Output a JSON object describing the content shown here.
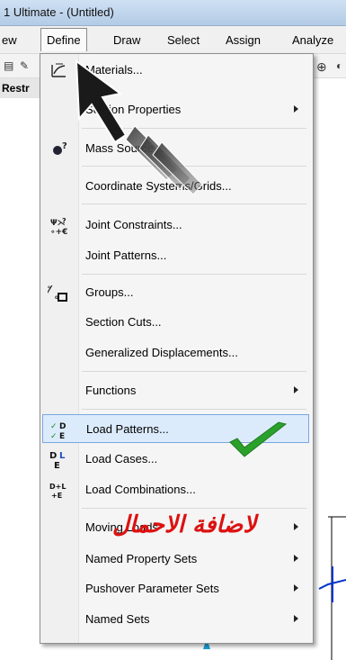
{
  "window": {
    "title": "1 Ultimate  - (Untitled)"
  },
  "menubar": {
    "items": [
      {
        "label": "ew"
      },
      {
        "label": "Define"
      },
      {
        "label": "Draw"
      },
      {
        "label": "Select"
      },
      {
        "label": "Assign"
      },
      {
        "label": "Analyze"
      }
    ]
  },
  "subbar": {
    "label": "Restr"
  },
  "define_menu": {
    "items": [
      {
        "label": "Materials...",
        "icon": "materials-icon",
        "submenu": false
      },
      {
        "label": "Section Properties",
        "icon": "",
        "submenu": true
      },
      {
        "label": "Mass Source...",
        "icon": "mass-source-icon",
        "submenu": false
      },
      {
        "label": "Coordinate Systems/Grids...",
        "icon": "",
        "submenu": false
      },
      {
        "label": "Joint Constraints...",
        "icon": "joint-constraints-icon",
        "submenu": false
      },
      {
        "label": "Joint Patterns...",
        "icon": "",
        "submenu": false
      },
      {
        "label": "Groups...",
        "icon": "groups-icon",
        "submenu": false
      },
      {
        "label": "Section Cuts...",
        "icon": "",
        "submenu": false
      },
      {
        "label": "Generalized Displacements...",
        "icon": "",
        "submenu": false
      },
      {
        "label": "Functions",
        "icon": "",
        "submenu": true
      },
      {
        "label": "Load Patterns...",
        "icon": "load-patterns-icon",
        "submenu": false,
        "highlighted": true
      },
      {
        "label": "Load Cases...",
        "icon": "load-cases-icon",
        "submenu": false
      },
      {
        "label": "Load Combinations...",
        "icon": "load-combinations-icon",
        "submenu": false
      },
      {
        "label": "Moving Loads",
        "icon": "",
        "submenu": true
      },
      {
        "label": "Named Property Sets",
        "icon": "",
        "submenu": true
      },
      {
        "label": "Pushover Parameter Sets",
        "icon": "",
        "submenu": true
      },
      {
        "label": "Named Sets",
        "icon": "",
        "submenu": true
      }
    ]
  },
  "icon_glyphs": {
    "load_patterns": "✓D ✓E",
    "load_cases": "D L E",
    "load_combinations": "D+L +E",
    "groups": "⁄□"
  },
  "annotation": {
    "arabic_text": "لاضافة الاحمال",
    "color": "#d11111",
    "checkmark_color": "#2aa12a"
  }
}
